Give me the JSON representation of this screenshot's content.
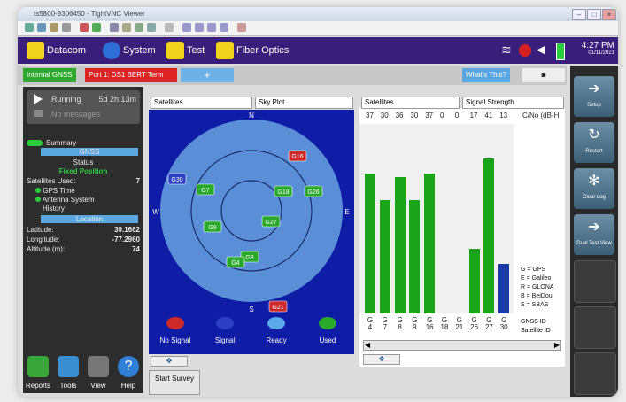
{
  "window": {
    "title": "ts5800-9306450 - TightVNC Viewer"
  },
  "menubar": {
    "items": [
      {
        "label": "Datacom",
        "icon": "datacom-icon"
      },
      {
        "label": "System",
        "icon": "gear-icon"
      },
      {
        "label": "Test",
        "icon": "test-icon"
      },
      {
        "label": "Fiber Optics",
        "icon": "fiber-optics-icon"
      }
    ],
    "time": "4:27 PM",
    "date": "01/11/2021"
  },
  "tabs": {
    "internal_gnss": "Internal GNSS",
    "port": "Port 1: DS1 BERT Term",
    "add": "+",
    "whats_this": "What's This?"
  },
  "status": {
    "running": "Running",
    "duration": "5d 2h:13m",
    "messages": "No messages"
  },
  "left": {
    "summary": "Summary",
    "gnss_header": "GNSS",
    "status_label": "Status",
    "status_value": "Fixed Position",
    "sat_used_label": "Satellites Used:",
    "sat_used_value": "7",
    "tree": [
      "GPS Time",
      "Antenna System",
      "History"
    ],
    "location_header": "Location",
    "latitude_label": "Latitude:",
    "latitude_value": "39.1662",
    "longitude_label": "Longitude:",
    "longitude_value": "-77.2960",
    "altitude_label": "Altitude (m):",
    "altitude_value": "74"
  },
  "bottom_icons": [
    {
      "label": "Reports",
      "icon": "reports-icon",
      "color": "#3aa63a"
    },
    {
      "label": "Tools",
      "icon": "tools-icon",
      "color": "#3b8ed0"
    },
    {
      "label": "View",
      "icon": "view-icon",
      "color": "#777777"
    },
    {
      "label": "Help",
      "icon": "help-icon",
      "color": "#2f7fd6"
    }
  ],
  "skyplot": {
    "select1": "Satellites",
    "select2": "Sky Plot",
    "compass": {
      "n": "N",
      "s": "S",
      "e": "E",
      "w": "W"
    },
    "satellites": [
      {
        "id": "G16",
        "state": "no-signal"
      },
      {
        "id": "G30",
        "state": "signal"
      },
      {
        "id": "G7",
        "state": "used"
      },
      {
        "id": "G18",
        "state": "used"
      },
      {
        "id": "G26",
        "state": "used"
      },
      {
        "id": "G27",
        "state": "used"
      },
      {
        "id": "G9",
        "state": "used"
      },
      {
        "id": "G8",
        "state": "used"
      },
      {
        "id": "G4",
        "state": "used"
      },
      {
        "id": "G21",
        "state": "no-signal"
      }
    ],
    "legend": [
      {
        "label": "No Signal",
        "color": "#cc2a2a"
      },
      {
        "label": "Signal",
        "color": "#2c3fc2"
      },
      {
        "label": "Ready",
        "color": "#5aa8e8"
      },
      {
        "label": "Used",
        "color": "#2aa82a"
      }
    ]
  },
  "signal": {
    "select1": "Satellites",
    "select2": "Signal Strength",
    "cno_label": "C/No (dB-H",
    "ids": [
      "G4",
      "G7",
      "G8",
      "G9",
      "G16",
      "G18",
      "G21",
      "G26",
      "G27",
      "G30"
    ],
    "cno": [
      "37",
      "30",
      "36",
      "30",
      "37",
      "0",
      "0",
      "17",
      "41",
      "13"
    ],
    "legend": [
      "G = GPS",
      "E = Galileo",
      "R = GLONA",
      "B = BeiDou",
      "S = SBAS"
    ],
    "gnss_id": "GNSS ID",
    "sat_id": "Satellite ID"
  },
  "chart_data": {
    "type": "bar",
    "categories": [
      "G4",
      "G7",
      "G8",
      "G9",
      "G16",
      "G18",
      "G21",
      "G26",
      "G27",
      "G30"
    ],
    "series": [
      {
        "values": [
          37,
          30,
          36,
          30,
          37,
          0,
          0,
          17,
          41,
          13
        ]
      }
    ],
    "colors": [
      "#1aa51a",
      "#1aa51a",
      "#1aa51a",
      "#1aa51a",
      "#1aa51a",
      "#1aa51a",
      "#1aa51a",
      "#1aa51a",
      "#1aa51a",
      "#1c3aa8"
    ],
    "ylim": [
      0,
      50
    ],
    "ylabel": "C/No (dB-H"
  },
  "right_buttons": [
    {
      "label": "Setup",
      "icon": "arrow-right-icon"
    },
    {
      "label": "Restart",
      "icon": "restart-icon"
    },
    {
      "label": "Clear Log",
      "icon": "clear-log-icon"
    },
    {
      "label": "Dual Test View",
      "icon": "arrow-right-icon"
    }
  ],
  "survey": {
    "label": "Start Survey"
  }
}
